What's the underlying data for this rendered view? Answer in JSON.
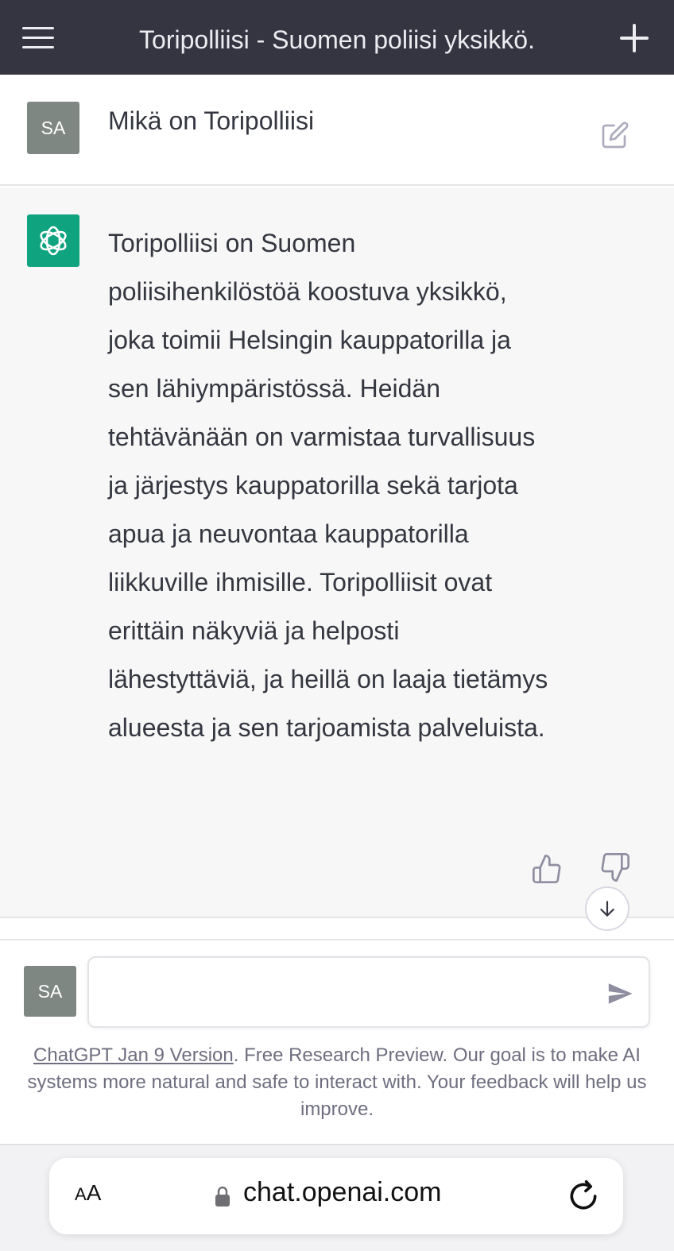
{
  "header": {
    "title": "Toripolliisi - Suomen poliisi yksikkö.",
    "menu_icon": "hamburger-menu-icon",
    "new_chat_icon": "plus-icon"
  },
  "conversation": {
    "user_message": {
      "avatar_initials": "SA",
      "text": "Mikä on Toripolliisi",
      "edit_icon": "edit-icon"
    },
    "assistant_message": {
      "avatar_icon": "openai-logo-icon",
      "text": "Toripolliisi on Suomen poliisihenkilöstöä koostuva yksikkö, joka toimii Helsingin kauppatorilla ja sen lähiympäristössä. Heidän tehtävänään on varmistaa turvallisuus ja järjestys kauppatorilla sekä tarjota apua ja neuvontaa kauppatorilla liikkuville ihmisille. Toripolliisit ovat erittäin näkyviä ja helposti lähestyttäviä, ja heillä on laaja tietämys alueesta ja sen tarjoamista palveluista.",
      "feedback_icons": [
        "thumbs-up-icon",
        "thumbs-down-icon"
      ]
    }
  },
  "composer": {
    "avatar_initials": "SA",
    "input_value": "",
    "input_placeholder": "",
    "send_icon": "send-icon",
    "scroll_icon": "arrow-down-icon"
  },
  "footer": {
    "version_link": "ChatGPT Jan 9 Version",
    "text": ". Free Research Preview. Our goal is to make AI systems more natural and safe to interact with. Your feedback will help us improve."
  },
  "browser": {
    "text_size_label_large": "A",
    "text_size_label_small": "A",
    "url": "chat.openai.com",
    "lock_icon": "lock-icon",
    "reload_icon": "reload-icon"
  },
  "colors": {
    "header_bg": "#343541",
    "assistant_bg": "#f7f7f8",
    "assistant_avatar": "#10a37f",
    "user_avatar": "#7f8783"
  }
}
